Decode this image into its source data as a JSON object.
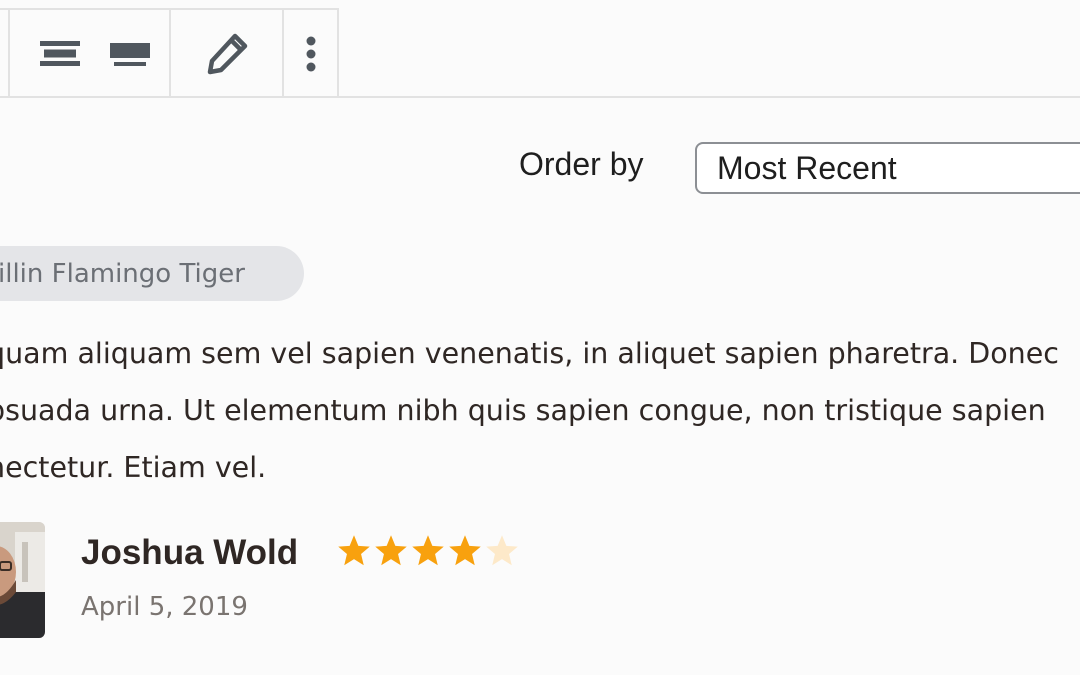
{
  "toolbar": {
    "buttons": [
      {
        "name": "align-center",
        "icon": "align-center-icon"
      },
      {
        "name": "align-wide",
        "icon": "align-wide-icon"
      },
      {
        "name": "edit",
        "icon": "pencil-icon"
      },
      {
        "name": "more-options",
        "icon": "vertical-ellipsis-icon"
      }
    ]
  },
  "order": {
    "label": "Order by",
    "selected": "Most Recent"
  },
  "review": {
    "tag": "illin Flamingo Tiger",
    "text_lines": [
      "quam aliquam sem vel sapien venenatis, in aliquet sapien pharetra. Donec",
      "psuada urna. Ut elementum nibh quis sapien congue, non tristique sapien",
      "nectetur. Etiam vel."
    ],
    "author": "Joshua Wold",
    "date": "April 5, 2019",
    "rating": 4,
    "rating_max": 5
  },
  "colors": {
    "star_filled": "#f8a10e",
    "star_empty": "#fde9c9",
    "icon": "#50575e",
    "border": "#e2e2e2"
  }
}
